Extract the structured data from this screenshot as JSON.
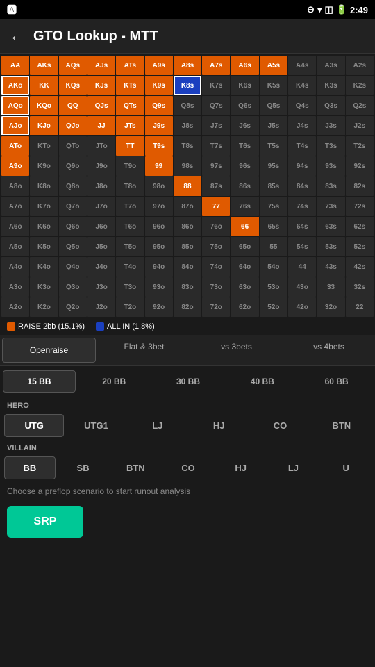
{
  "statusBar": {
    "leftIcon": "A",
    "time": "2:49"
  },
  "header": {
    "title": "GTO Lookup - MTT",
    "backLabel": "←"
  },
  "grid": {
    "rows": [
      [
        {
          "label": "AA",
          "type": "orange"
        },
        {
          "label": "AKs",
          "type": "orange"
        },
        {
          "label": "AQs",
          "type": "orange"
        },
        {
          "label": "AJs",
          "type": "orange"
        },
        {
          "label": "ATs",
          "type": "orange"
        },
        {
          "label": "A9s",
          "type": "orange"
        },
        {
          "label": "A8s",
          "type": "orange"
        },
        {
          "label": "A7s",
          "type": "orange"
        },
        {
          "label": "A6s",
          "type": "orange"
        },
        {
          "label": "A5s",
          "type": "orange"
        },
        {
          "label": "A4s",
          "type": "dark"
        },
        {
          "label": "A3s",
          "type": "dark"
        },
        {
          "label": "A2s",
          "type": "dark"
        }
      ],
      [
        {
          "label": "AKo",
          "type": "orange-sel"
        },
        {
          "label": "KK",
          "type": "orange"
        },
        {
          "label": "KQs",
          "type": "orange"
        },
        {
          "label": "KJs",
          "type": "orange"
        },
        {
          "label": "KTs",
          "type": "orange"
        },
        {
          "label": "K9s",
          "type": "orange"
        },
        {
          "label": "K8s",
          "type": "blue-sel"
        },
        {
          "label": "K7s",
          "type": "dark"
        },
        {
          "label": "K6s",
          "type": "dark"
        },
        {
          "label": "K5s",
          "type": "dark"
        },
        {
          "label": "K4s",
          "type": "dark"
        },
        {
          "label": "K3s",
          "type": "dark"
        },
        {
          "label": "K2s",
          "type": "dark"
        }
      ],
      [
        {
          "label": "AQo",
          "type": "orange-sel"
        },
        {
          "label": "KQo",
          "type": "orange"
        },
        {
          "label": "QQ",
          "type": "orange"
        },
        {
          "label": "QJs",
          "type": "orange"
        },
        {
          "label": "QTs",
          "type": "orange"
        },
        {
          "label": "Q9s",
          "type": "orange"
        },
        {
          "label": "Q8s",
          "type": "dark"
        },
        {
          "label": "Q7s",
          "type": "dark"
        },
        {
          "label": "Q6s",
          "type": "dark"
        },
        {
          "label": "Q5s",
          "type": "dark"
        },
        {
          "label": "Q4s",
          "type": "dark"
        },
        {
          "label": "Q3s",
          "type": "dark"
        },
        {
          "label": "Q2s",
          "type": "dark"
        }
      ],
      [
        {
          "label": "AJo",
          "type": "orange-sel"
        },
        {
          "label": "KJo",
          "type": "orange"
        },
        {
          "label": "QJo",
          "type": "orange"
        },
        {
          "label": "JJ",
          "type": "orange"
        },
        {
          "label": "JTs",
          "type": "orange"
        },
        {
          "label": "J9s",
          "type": "orange"
        },
        {
          "label": "J8s",
          "type": "dark"
        },
        {
          "label": "J7s",
          "type": "dark"
        },
        {
          "label": "J6s",
          "type": "dark"
        },
        {
          "label": "J5s",
          "type": "dark"
        },
        {
          "label": "J4s",
          "type": "dark"
        },
        {
          "label": "J3s",
          "type": "dark"
        },
        {
          "label": "J2s",
          "type": "dark"
        }
      ],
      [
        {
          "label": "ATo",
          "type": "orange"
        },
        {
          "label": "KTo",
          "type": "dark"
        },
        {
          "label": "QTo",
          "type": "dark"
        },
        {
          "label": "JTo",
          "type": "dark"
        },
        {
          "label": "TT",
          "type": "orange"
        },
        {
          "label": "T9s",
          "type": "orange"
        },
        {
          "label": "T8s",
          "type": "dark"
        },
        {
          "label": "T7s",
          "type": "dark"
        },
        {
          "label": "T6s",
          "type": "dark"
        },
        {
          "label": "T5s",
          "type": "dark"
        },
        {
          "label": "T4s",
          "type": "dark"
        },
        {
          "label": "T3s",
          "type": "dark"
        },
        {
          "label": "T2s",
          "type": "dark"
        }
      ],
      [
        {
          "label": "A9o",
          "type": "orange"
        },
        {
          "label": "K9o",
          "type": "dark"
        },
        {
          "label": "Q9o",
          "type": "dark"
        },
        {
          "label": "J9o",
          "type": "dark"
        },
        {
          "label": "T9o",
          "type": "dark"
        },
        {
          "label": "99",
          "type": "orange"
        },
        {
          "label": "98s",
          "type": "dark"
        },
        {
          "label": "97s",
          "type": "dark"
        },
        {
          "label": "96s",
          "type": "dark"
        },
        {
          "label": "95s",
          "type": "dark"
        },
        {
          "label": "94s",
          "type": "dark"
        },
        {
          "label": "93s",
          "type": "dark"
        },
        {
          "label": "92s",
          "type": "dark"
        }
      ],
      [
        {
          "label": "A8o",
          "type": "dark"
        },
        {
          "label": "K8o",
          "type": "dark"
        },
        {
          "label": "Q8o",
          "type": "dark"
        },
        {
          "label": "J8o",
          "type": "dark"
        },
        {
          "label": "T8o",
          "type": "dark"
        },
        {
          "label": "98o",
          "type": "dark"
        },
        {
          "label": "88",
          "type": "orange"
        },
        {
          "label": "87s",
          "type": "dark"
        },
        {
          "label": "86s",
          "type": "dark"
        },
        {
          "label": "85s",
          "type": "dark"
        },
        {
          "label": "84s",
          "type": "dark"
        },
        {
          "label": "83s",
          "type": "dark"
        },
        {
          "label": "82s",
          "type": "dark"
        }
      ],
      [
        {
          "label": "A7o",
          "type": "dark"
        },
        {
          "label": "K7o",
          "type": "dark"
        },
        {
          "label": "Q7o",
          "type": "dark"
        },
        {
          "label": "J7o",
          "type": "dark"
        },
        {
          "label": "T7o",
          "type": "dark"
        },
        {
          "label": "97o",
          "type": "dark"
        },
        {
          "label": "87o",
          "type": "dark"
        },
        {
          "label": "77",
          "type": "orange"
        },
        {
          "label": "76s",
          "type": "dark"
        },
        {
          "label": "75s",
          "type": "dark"
        },
        {
          "label": "74s",
          "type": "dark"
        },
        {
          "label": "73s",
          "type": "dark"
        },
        {
          "label": "72s",
          "type": "dark"
        }
      ],
      [
        {
          "label": "A6o",
          "type": "dark"
        },
        {
          "label": "K6o",
          "type": "dark"
        },
        {
          "label": "Q6o",
          "type": "dark"
        },
        {
          "label": "J6o",
          "type": "dark"
        },
        {
          "label": "T6o",
          "type": "dark"
        },
        {
          "label": "96o",
          "type": "dark"
        },
        {
          "label": "86o",
          "type": "dark"
        },
        {
          "label": "76o",
          "type": "dark"
        },
        {
          "label": "66",
          "type": "orange"
        },
        {
          "label": "65s",
          "type": "dark"
        },
        {
          "label": "64s",
          "type": "dark"
        },
        {
          "label": "63s",
          "type": "dark"
        },
        {
          "label": "62s",
          "type": "dark"
        }
      ],
      [
        {
          "label": "A5o",
          "type": "dark"
        },
        {
          "label": "K5o",
          "type": "dark"
        },
        {
          "label": "Q5o",
          "type": "dark"
        },
        {
          "label": "J5o",
          "type": "dark"
        },
        {
          "label": "T5o",
          "type": "dark"
        },
        {
          "label": "95o",
          "type": "dark"
        },
        {
          "label": "85o",
          "type": "dark"
        },
        {
          "label": "75o",
          "type": "dark"
        },
        {
          "label": "65o",
          "type": "dark"
        },
        {
          "label": "55",
          "type": "dark"
        },
        {
          "label": "54s",
          "type": "dark"
        },
        {
          "label": "53s",
          "type": "dark"
        },
        {
          "label": "52s",
          "type": "dark"
        }
      ],
      [
        {
          "label": "A4o",
          "type": "dark"
        },
        {
          "label": "K4o",
          "type": "dark"
        },
        {
          "label": "Q4o",
          "type": "dark"
        },
        {
          "label": "J4o",
          "type": "dark"
        },
        {
          "label": "T4o",
          "type": "dark"
        },
        {
          "label": "94o",
          "type": "dark"
        },
        {
          "label": "84o",
          "type": "dark"
        },
        {
          "label": "74o",
          "type": "dark"
        },
        {
          "label": "64o",
          "type": "dark"
        },
        {
          "label": "54o",
          "type": "dark"
        },
        {
          "label": "44",
          "type": "dark"
        },
        {
          "label": "43s",
          "type": "dark"
        },
        {
          "label": "42s",
          "type": "dark"
        }
      ],
      [
        {
          "label": "A3o",
          "type": "dark"
        },
        {
          "label": "K3o",
          "type": "dark"
        },
        {
          "label": "Q3o",
          "type": "dark"
        },
        {
          "label": "J3o",
          "type": "dark"
        },
        {
          "label": "T3o",
          "type": "dark"
        },
        {
          "label": "93o",
          "type": "dark"
        },
        {
          "label": "83o",
          "type": "dark"
        },
        {
          "label": "73o",
          "type": "dark"
        },
        {
          "label": "63o",
          "type": "dark"
        },
        {
          "label": "53o",
          "type": "dark"
        },
        {
          "label": "43o",
          "type": "dark"
        },
        {
          "label": "33",
          "type": "dark"
        },
        {
          "label": "32s",
          "type": "dark"
        }
      ],
      [
        {
          "label": "A2o",
          "type": "dark"
        },
        {
          "label": "K2o",
          "type": "dark"
        },
        {
          "label": "Q2o",
          "type": "dark"
        },
        {
          "label": "J2o",
          "type": "dark"
        },
        {
          "label": "T2o",
          "type": "dark"
        },
        {
          "label": "92o",
          "type": "dark"
        },
        {
          "label": "82o",
          "type": "dark"
        },
        {
          "label": "72o",
          "type": "dark"
        },
        {
          "label": "62o",
          "type": "dark"
        },
        {
          "label": "52o",
          "type": "dark"
        },
        {
          "label": "42o",
          "type": "dark"
        },
        {
          "label": "32o",
          "type": "dark"
        },
        {
          "label": "22",
          "type": "dark"
        }
      ]
    ]
  },
  "legend": {
    "items": [
      {
        "label": "RAISE 2bb (15.1%)",
        "color": "#e05a00"
      },
      {
        "label": "ALL IN (1.8%)",
        "color": "#1a3fbf"
      }
    ]
  },
  "tabs": [
    {
      "label": "Openraise",
      "active": true
    },
    {
      "label": "Flat & 3bet",
      "active": false
    },
    {
      "label": "vs 3bets",
      "active": false
    },
    {
      "label": "vs 4bets",
      "active": false
    }
  ],
  "bbOptions": [
    {
      "label": "15 BB",
      "active": true
    },
    {
      "label": "20 BB",
      "active": false
    },
    {
      "label": "30 BB",
      "active": false
    },
    {
      "label": "40 BB",
      "active": false
    },
    {
      "label": "60 BB",
      "active": false
    }
  ],
  "heroLabel": "HERO",
  "heroPositions": [
    {
      "label": "UTG",
      "active": true
    },
    {
      "label": "UTG1",
      "active": false
    },
    {
      "label": "LJ",
      "active": false
    },
    {
      "label": "HJ",
      "active": false
    },
    {
      "label": "CO",
      "active": false
    },
    {
      "label": "BTN",
      "active": false
    }
  ],
  "villainLabel": "VILLAIN",
  "villainPositions": [
    {
      "label": "BB",
      "active": true
    },
    {
      "label": "SB",
      "active": false
    },
    {
      "label": "BTN",
      "active": false
    },
    {
      "label": "CO",
      "active": false
    },
    {
      "label": "HJ",
      "active": false
    },
    {
      "label": "LJ",
      "active": false
    },
    {
      "label": "U",
      "active": false
    }
  ],
  "bottomInfo": "Choose a preflop scenario to start runout analysis",
  "srpButton": "SRP"
}
